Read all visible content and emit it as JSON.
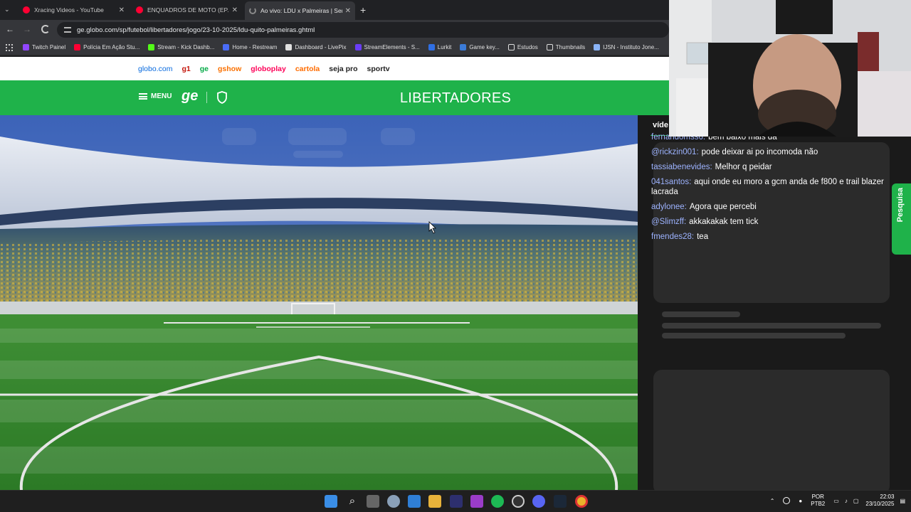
{
  "browser": {
    "tabs": [
      {
        "title": "Xracing Videos - YouTube",
        "color": "#ff0033"
      },
      {
        "title": "ENQUADROS DE MOTO (EP. 12",
        "color": "#ff0033"
      },
      {
        "title": "Ao vivo: LDU x Palmeiras | Sem",
        "color": "#8a8a8a"
      }
    ],
    "new_tab": "+",
    "url": "ge.globo.com/sp/futebol/libertadores/jogo/23-10-2025/ldu-quito-palmeiras.ghtml",
    "bookmarks": [
      {
        "label": "Twitch Painel",
        "color": "#9146ff"
      },
      {
        "label": "Polícia Em Ação Stu...",
        "color": "#ff0033"
      },
      {
        "label": "Stream - Kick Dashb...",
        "color": "#53fc18"
      },
      {
        "label": "Home - Restream",
        "color": "#4a6cf7"
      },
      {
        "label": "Dashboard - LivePix",
        "color": "#e0e0e0"
      },
      {
        "label": "StreamElements - S...",
        "color": "#6a3df7"
      },
      {
        "label": "Lurkit",
        "color": "#2f6fe4"
      },
      {
        "label": "Game key...",
        "color": "#3b7bd8"
      },
      {
        "label": "Estudos",
        "color": "folder"
      },
      {
        "label": "Thumbnails",
        "color": "folder"
      },
      {
        "label": "IJSN - Instituto Jone...",
        "color": "#8ab4f8"
      }
    ]
  },
  "globo_nav": [
    {
      "label": "globo.com",
      "color": "#0669de"
    },
    {
      "label": "g1",
      "color": "#c4170c"
    },
    {
      "label": "ge",
      "color": "#06aa48"
    },
    {
      "label": "gshow",
      "color": "#fa7000"
    },
    {
      "label": "globoplay",
      "color": "#fd0359"
    },
    {
      "label": "cartola",
      "color": "#ff6c00"
    },
    {
      "label": "seja pro",
      "color": "#222222"
    },
    {
      "label": "sportv",
      "color": "#222222"
    }
  ],
  "header": {
    "menu_label": "MENU",
    "logo": "ge",
    "league": "LIBERTADORES",
    "accent": "#1fb24a"
  },
  "side_tab_label": "víde",
  "survey_tab": "Pesquisa",
  "chat": [
    {
      "user": "fernandomss6:",
      "text": "bem baixo mais dá"
    },
    {
      "user": "@rickzin001:",
      "text": "pode deixar ai po incomoda não"
    },
    {
      "user": "tassiabenevides:",
      "text": "Melhor q peidar"
    },
    {
      "user": "041santos:",
      "text": "aqui onde eu moro a gcm anda de f800 e trail blazer lacrada"
    },
    {
      "user": "adylonee:",
      "text": "Agora que percebi"
    },
    {
      "user": "@Slimzff:",
      "text": "akkakakak tem tick"
    },
    {
      "user": "fmendes28:",
      "text": "tea"
    }
  ],
  "taskbar": {
    "lang": "POR",
    "layout": "PTB2",
    "time": "22:03",
    "date": "23/10/2025"
  }
}
